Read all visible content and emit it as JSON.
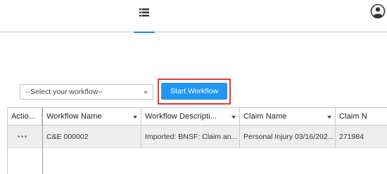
{
  "topbar": {
    "list_icon": "list-icon",
    "user_icon": "user-circle-icon",
    "accent_color": "#1e88e5"
  },
  "workflow": {
    "select_value": "--Select your workflow--",
    "start_button": "Start Workflow",
    "button_color": "#2196f3",
    "highlight_color": "#e53935"
  },
  "grid": {
    "columns": [
      {
        "label": "Actio..."
      },
      {
        "label": "Workflow Name"
      },
      {
        "label": "Workflow Descripti..."
      },
      {
        "label": "Claim Name"
      },
      {
        "label": "Claim N"
      }
    ],
    "rows": [
      {
        "action": "more-dots-icon",
        "workflow_name": "C&E 000002",
        "workflow_description": "Imported: BNSF: Claim an...",
        "claim_name": "Personal Injury 03/16/202...",
        "claim_number": "271984"
      }
    ]
  }
}
